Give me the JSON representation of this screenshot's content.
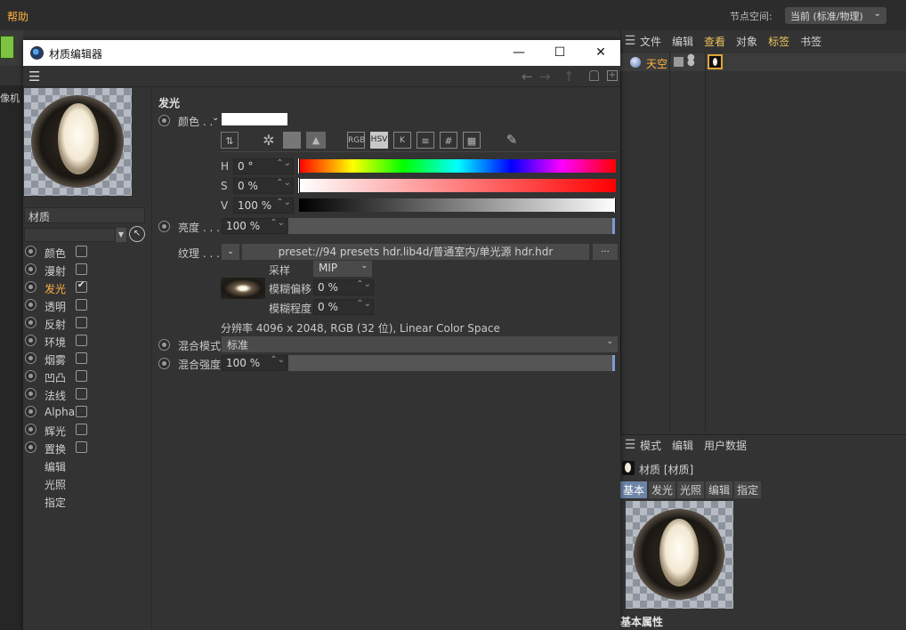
{
  "app": {
    "menu_help": "帮助",
    "nodespace_label": "节点空间:",
    "nodespace_value": "当前 (标准/物理)",
    "viewport_label": "像机"
  },
  "object_manager": {
    "menu": [
      "文件",
      "编辑",
      "查看",
      "对象",
      "标签",
      "书签"
    ],
    "objects": [
      {
        "name": "天空",
        "icon": "sky-icon",
        "tag": "material-tag"
      }
    ]
  },
  "attribute_manager": {
    "menu": [
      "模式",
      "编辑",
      "用户数据"
    ],
    "title": "材质 [材质]",
    "tabs": [
      "基本",
      "发光",
      "光照",
      "编辑",
      "指定"
    ],
    "active_tab": "基本",
    "section": "基本属性"
  },
  "material_editor": {
    "window_title": "材质编辑器",
    "window_buttons": {
      "minimize": "—",
      "maximize": "☐",
      "close": "✕"
    },
    "material_name": "材质",
    "channels": [
      {
        "label": "颜色",
        "checked": false,
        "has_radio": true
      },
      {
        "label": "漫射",
        "checked": false,
        "has_radio": true
      },
      {
        "label": "发光",
        "checked": true,
        "has_radio": true,
        "active": true
      },
      {
        "label": "透明",
        "checked": false,
        "has_radio": true
      },
      {
        "label": "反射",
        "checked": false,
        "has_radio": true
      },
      {
        "label": "环境",
        "checked": false,
        "has_radio": true
      },
      {
        "label": "烟雾",
        "checked": false,
        "has_radio": true
      },
      {
        "label": "凹凸",
        "checked": false,
        "has_radio": true
      },
      {
        "label": "法线",
        "checked": false,
        "has_radio": true
      },
      {
        "label": "Alpha",
        "checked": false,
        "has_radio": true
      },
      {
        "label": "辉光",
        "checked": false,
        "has_radio": true
      },
      {
        "label": "置换",
        "checked": false,
        "has_radio": true
      },
      {
        "label": "编辑",
        "checked": null,
        "has_radio": false
      },
      {
        "label": "光照",
        "checked": null,
        "has_radio": false
      },
      {
        "label": "指定",
        "checked": null,
        "has_radio": false
      }
    ],
    "section_title": "发光",
    "color_label": "颜色 . .",
    "color_value_hex": "#ffffff",
    "color_modes": [
      "RGB",
      "HSV",
      "K",
      "#"
    ],
    "active_color_mode": "HSV",
    "hsv": {
      "h_label": "H",
      "h_value": "0 °",
      "s_label": "S",
      "s_value": "0 %",
      "v_label": "V",
      "v_value": "100 %"
    },
    "brightness_label": "亮度 . . .",
    "brightness_value": "100 %",
    "brightness_fraction": 1.0,
    "texture_label": "纹理 . . .",
    "texture_path": "preset://94 presets hdr.lib4d/普通室内/单光源 hdr.hdr",
    "texture_more": "...",
    "sampling_label": "采样",
    "sampling_value": "MIP",
    "blur_offset_label": "模糊偏移",
    "blur_offset_value": "0 %",
    "blur_scale_label": "模糊程度",
    "blur_scale_value": "0 %",
    "texture_info": "分辨率 4096 x 2048, RGB (32 位), Linear Color Space",
    "blend_mode_label": "混合模式",
    "blend_mode_value": "标准",
    "blend_strength_label": "混合强度",
    "blend_strength_value": "100 %",
    "blend_strength_fraction": 1.0
  },
  "colors": {
    "accent_orange": "#ffb23f",
    "highlight_yellow": "#e7c25a",
    "slider_handle": "#7d9bd1",
    "active_tab": "#6c84a6"
  }
}
